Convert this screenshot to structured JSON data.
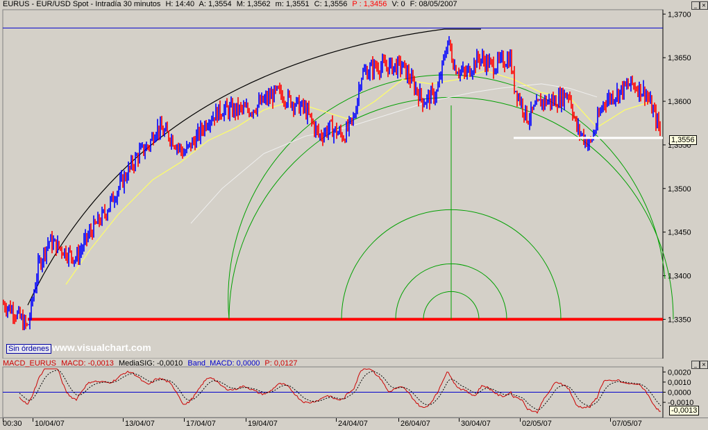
{
  "header": {
    "symbol": "EURUS - EUR/USD Spot - Intradía 30 minutos",
    "h": "H: 14:40",
    "a": "A: 1,3554",
    "m_high": "M: 1,3562",
    "m_low": "m: 1,3551",
    "c": "C: 1,3556",
    "p": "P : 1,3456",
    "v": "V: 0",
    "f": "F: 08/05/2007"
  },
  "macd_header": {
    "name": "MACD_EURUS",
    "macd": "MACD: -0,0013",
    "signal": "MediaSIG: -0,0010",
    "band": "Band_MACD: 0,0000",
    "p": "P: 0,0127"
  },
  "badge": {
    "orders": "Sin órdenes",
    "watermark": "www.visualchart.com"
  },
  "price_tag": "1,3556",
  "macd_tag": "-0,0013",
  "colors": {
    "bg": "#d4d0c8",
    "up": "#0000ff",
    "down": "#ff0000",
    "ma": "#ffff66",
    "ma2": "#f0f0f0",
    "circle": "#00a000",
    "support": "#ff0000",
    "resistance": "#0000cc"
  },
  "chart_data": [
    {
      "type": "candlestick",
      "ylim": [
        1.3305,
        1.3705
      ],
      "yticks": [
        "1,3700",
        "1,3650",
        "1,3600",
        "1,3550",
        "1,3500",
        "1,3450",
        "1,3400",
        "1,3350"
      ],
      "xticks": [
        "00:30",
        "10/04/07",
        "13/04/07",
        "17/04/07",
        "19/04/07",
        "24/04/07",
        "26/04/07",
        "30/04/07",
        "02/05/07",
        "07/05/07"
      ],
      "price_path": [
        [
          0,
          1.337
        ],
        [
          20,
          1.336
        ],
        [
          40,
          1.334
        ],
        [
          55,
          1.341
        ],
        [
          70,
          1.344
        ],
        [
          90,
          1.343
        ],
        [
          110,
          1.342
        ],
        [
          130,
          1.345
        ],
        [
          150,
          1.347
        ],
        [
          170,
          1.35
        ],
        [
          200,
          1.354
        ],
        [
          215,
          1.355
        ],
        [
          225,
          1.357
        ],
        [
          245,
          1.356
        ],
        [
          265,
          1.354
        ],
        [
          285,
          1.356
        ],
        [
          300,
          1.358
        ],
        [
          320,
          1.359
        ],
        [
          340,
          1.359
        ],
        [
          360,
          1.359
        ],
        [
          380,
          1.36
        ],
        [
          400,
          1.361
        ],
        [
          420,
          1.36
        ],
        [
          440,
          1.359
        ],
        [
          460,
          1.356
        ],
        [
          475,
          1.357
        ],
        [
          495,
          1.356
        ],
        [
          510,
          1.358
        ],
        [
          520,
          1.363
        ],
        [
          540,
          1.364
        ],
        [
          560,
          1.364
        ],
        [
          580,
          1.364
        ],
        [
          595,
          1.362
        ],
        [
          610,
          1.36
        ],
        [
          630,
          1.361
        ],
        [
          645,
          1.367
        ],
        [
          655,
          1.364
        ],
        [
          670,
          1.363
        ],
        [
          690,
          1.365
        ],
        [
          710,
          1.364
        ],
        [
          735,
          1.365
        ],
        [
          740,
          1.362
        ],
        [
          760,
          1.358
        ],
        [
          780,
          1.36
        ],
        [
          800,
          1.36
        ],
        [
          820,
          1.361
        ],
        [
          830,
          1.357
        ],
        [
          850,
          1.355
        ],
        [
          870,
          1.36
        ],
        [
          890,
          1.361
        ],
        [
          910,
          1.362
        ],
        [
          930,
          1.361
        ],
        [
          945,
          1.358
        ],
        [
          955,
          1.3556
        ]
      ],
      "ma_path": [
        [
          95,
          1.339
        ],
        [
          130,
          1.343
        ],
        [
          170,
          1.347
        ],
        [
          220,
          1.351
        ],
        [
          260,
          1.353
        ],
        [
          300,
          1.3555
        ],
        [
          340,
          1.357
        ],
        [
          380,
          1.359
        ],
        [
          420,
          1.36
        ],
        [
          460,
          1.359
        ],
        [
          500,
          1.358
        ],
        [
          540,
          1.36
        ],
        [
          580,
          1.3625
        ],
        [
          620,
          1.362
        ],
        [
          660,
          1.3625
        ],
        [
          700,
          1.3635
        ],
        [
          740,
          1.3625
        ],
        [
          780,
          1.361
        ],
        [
          820,
          1.3605
        ],
        [
          860,
          1.357
        ],
        [
          900,
          1.359
        ],
        [
          940,
          1.36
        ]
      ],
      "ma2_path": [
        [
          275,
          1.346
        ],
        [
          320,
          1.35
        ],
        [
          380,
          1.354
        ],
        [
          440,
          1.356
        ],
        [
          500,
          1.357
        ],
        [
          560,
          1.3585
        ],
        [
          620,
          1.36
        ],
        [
          680,
          1.361
        ],
        [
          720,
          1.3615
        ],
        [
          780,
          1.362
        ],
        [
          820,
          1.3615
        ],
        [
          860,
          1.3605
        ]
      ],
      "resistance": 1.3684,
      "support": 1.335,
      "white_line": 1.3558,
      "arc_peak": 1.3684,
      "macd": {
        "ylim": [
          -0.0025,
          0.0025
        ],
        "yticks": [
          "0,0020",
          "0,0010",
          "0,0000",
          "-0,0010"
        ],
        "zero": 0
      }
    }
  ]
}
